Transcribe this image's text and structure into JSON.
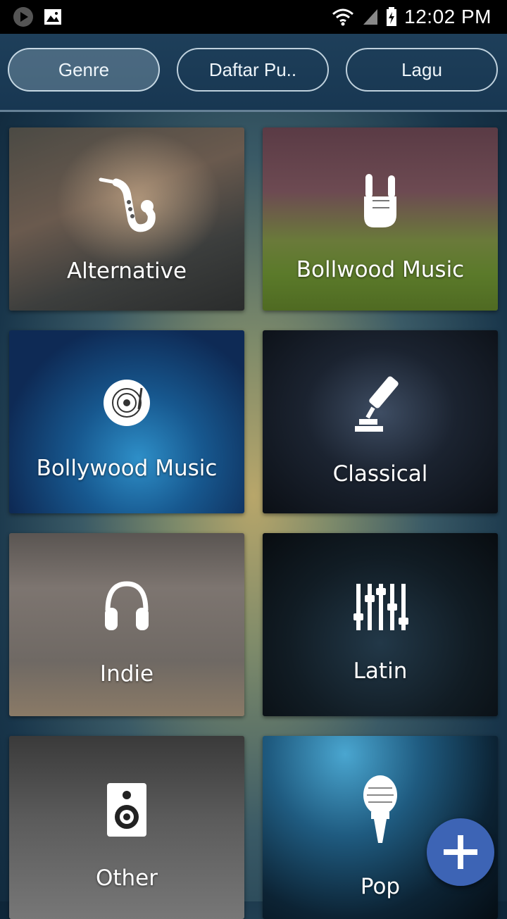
{
  "status_bar": {
    "time": "12:02 PM",
    "icons": [
      "play-icon",
      "image-icon",
      "wifi-icon",
      "signal-icon",
      "battery-icon"
    ]
  },
  "tabs": [
    {
      "label": "Genre",
      "active": true
    },
    {
      "label": "Daftar Pu..",
      "active": false
    },
    {
      "label": "Lagu",
      "active": false
    }
  ],
  "genres": [
    {
      "label": "Alternative",
      "icon": "saxophone-icon"
    },
    {
      "label": "Bollwood Music",
      "icon": "rock-hand-icon"
    },
    {
      "label": "Bollywood Music",
      "icon": "vinyl-disc-icon"
    },
    {
      "label": "Classical",
      "icon": "microphone-stand-icon"
    },
    {
      "label": "Indie",
      "icon": "headphones-icon"
    },
    {
      "label": "Latin",
      "icon": "equalizer-icon"
    },
    {
      "label": "Other",
      "icon": "speaker-icon"
    },
    {
      "label": "Pop",
      "icon": "microphone-icon"
    }
  ],
  "fab": {
    "icon": "plus-icon"
  },
  "colors": {
    "accent": "#3d64b5",
    "status_bar": "#000000",
    "tab_bar": "#1e3f5a"
  }
}
